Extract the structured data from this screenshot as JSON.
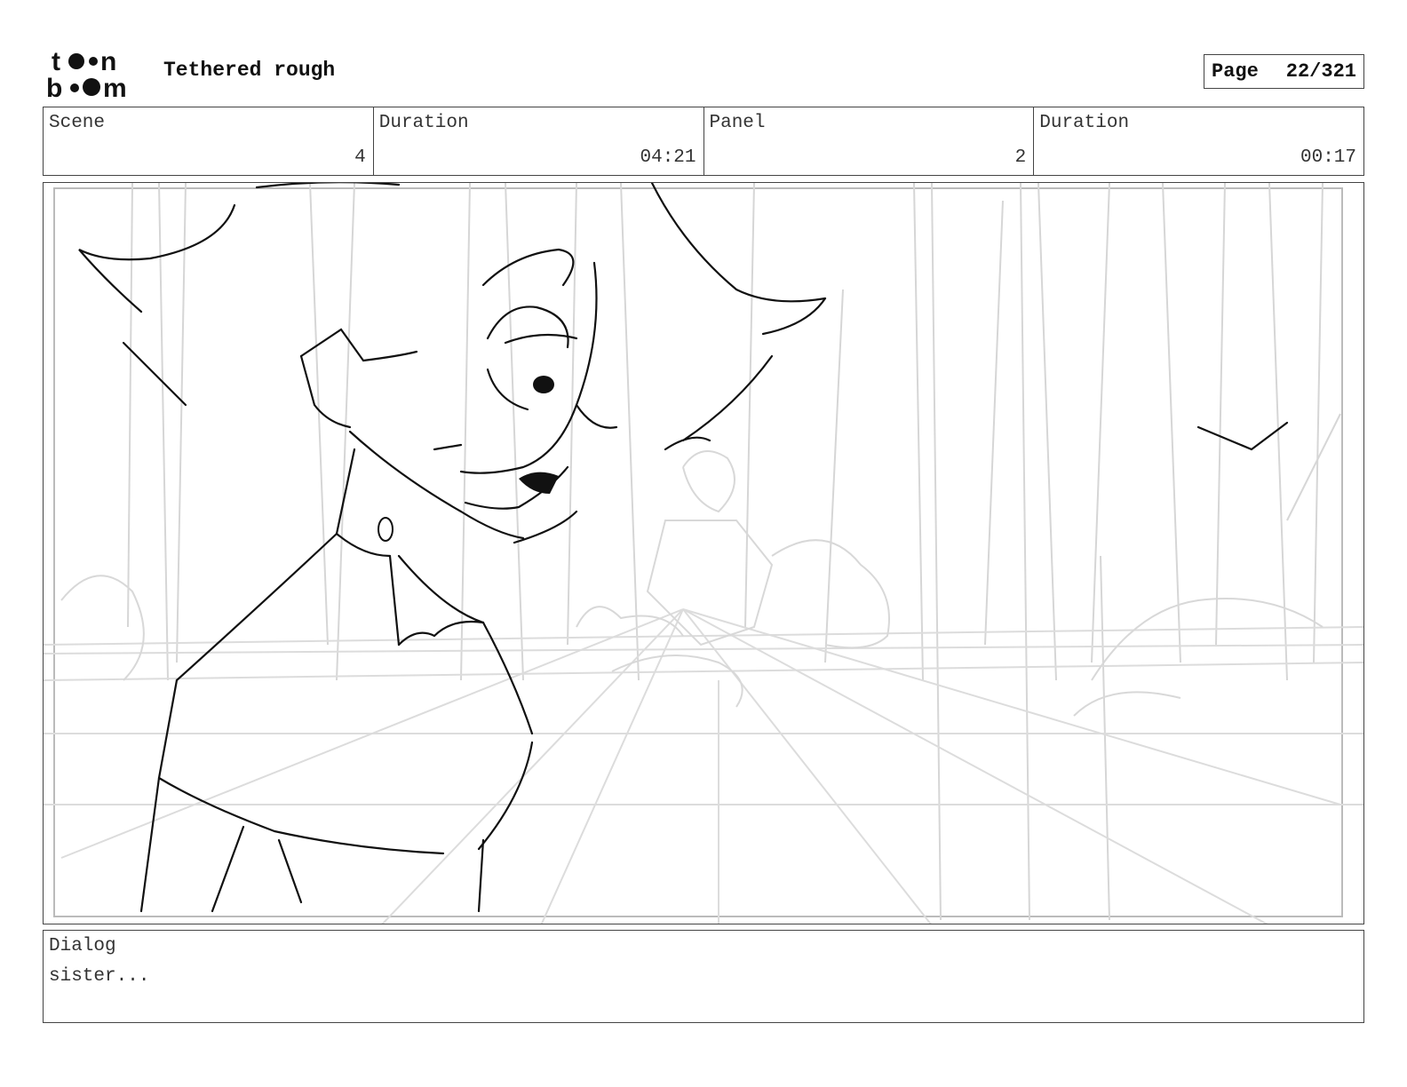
{
  "header": {
    "logo_text": "toon boom",
    "project_title": "Tethered rough",
    "page_label": "Page",
    "page_value": "22/321"
  },
  "info": {
    "scene_label": "Scene",
    "scene_value": "4",
    "scene_duration_label": "Duration",
    "scene_duration_value": "04:21",
    "panel_label": "Panel",
    "panel_value": "2",
    "panel_duration_label": "Duration",
    "panel_duration_value": "00:17"
  },
  "panel": {
    "image_description": "storyboard-sketch-character-leaning-forest-background"
  },
  "dialog": {
    "label": "Dialog",
    "text": "sister..."
  }
}
